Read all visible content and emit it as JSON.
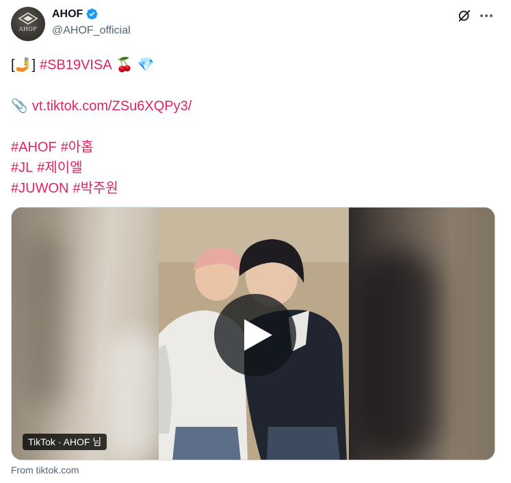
{
  "author": {
    "display_name": "AHOF",
    "handle": "@AHOF_official",
    "verified": true,
    "avatar_text": "AHOF"
  },
  "icons": {
    "verified": "verified-badge-icon",
    "grok": "grok-icon",
    "more": "more-options-icon",
    "link": "paperclip-icon"
  },
  "tweet": {
    "line1_open": "[",
    "line1_emoji": "🤳",
    "line1_close": "]",
    "line1_tag": "#SB19VISA",
    "line1_emoji_cherry": "🍒",
    "line1_emoji_gem": "💎",
    "link_emoji": "📎",
    "link_text": "vt.tiktok.com/ZSu6XQPy3/",
    "tag_ahof": "#AHOF",
    "tag_ahof_kr": "#아홉",
    "tag_jl": "#JL",
    "tag_jl_kr": "#제이엘",
    "tag_juwon": "#JUWON",
    "tag_juwon_kr": "#박주원"
  },
  "media": {
    "source_label": "TikTok · AHOF 님"
  },
  "card": {
    "from_text": "From tiktok.com"
  },
  "colors": {
    "hashtag": "#e0245e",
    "verified_badge": "#1d9bf0",
    "secondary_text": "#536471"
  }
}
